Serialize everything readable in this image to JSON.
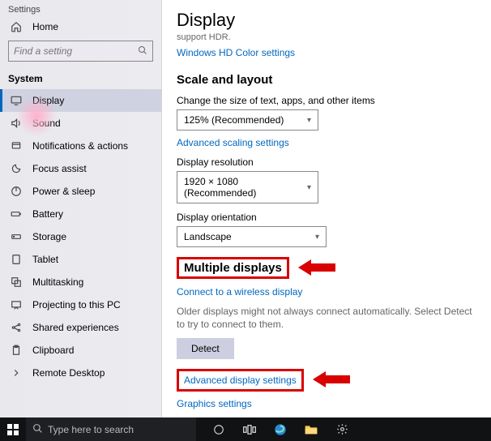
{
  "window": {
    "title": "Settings"
  },
  "sidebar": {
    "home": "Home",
    "search_placeholder": "Find a setting",
    "section": "System",
    "items": [
      {
        "label": "Display",
        "active": true,
        "icon": "display"
      },
      {
        "label": "Sound",
        "icon": "sound"
      },
      {
        "label": "Notifications & actions",
        "icon": "bell"
      },
      {
        "label": "Focus assist",
        "icon": "moon"
      },
      {
        "label": "Power & sleep",
        "icon": "power"
      },
      {
        "label": "Battery",
        "icon": "battery"
      },
      {
        "label": "Storage",
        "icon": "storage"
      },
      {
        "label": "Tablet",
        "icon": "tablet"
      },
      {
        "label": "Multitasking",
        "icon": "multi"
      },
      {
        "label": "Projecting to this PC",
        "icon": "project"
      },
      {
        "label": "Shared experiences",
        "icon": "share"
      },
      {
        "label": "Clipboard",
        "icon": "clip"
      },
      {
        "label": "Remote Desktop",
        "icon": "remote"
      }
    ]
  },
  "main": {
    "title": "Display",
    "subtitle": "support HDR.",
    "hd_link": "Windows HD Color settings",
    "scale_heading": "Scale and layout",
    "scale_label": "Change the size of text, apps, and other items",
    "scale_value": "125% (Recommended)",
    "adv_scaling": "Advanced scaling settings",
    "res_label": "Display resolution",
    "res_value": "1920 × 1080 (Recommended)",
    "orient_label": "Display orientation",
    "orient_value": "Landscape",
    "multi_heading": "Multiple displays",
    "wireless_link": "Connect to a wireless display",
    "help_text": "Older displays might not always connect automatically. Select Detect to try to connect to them.",
    "detect_btn": "Detect",
    "adv_display": "Advanced display settings",
    "graphics": "Graphics settings"
  },
  "taskbar": {
    "search_placeholder": "Type here to search"
  }
}
